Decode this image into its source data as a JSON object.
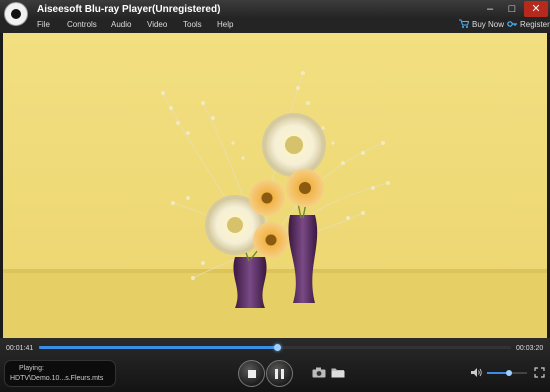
{
  "window": {
    "title": "Aiseesoft Blu-ray Player(Unregistered)",
    "minimize": "–",
    "maximize": "□",
    "close": "✕"
  },
  "menu": {
    "items": [
      "File",
      "Controls",
      "Audio",
      "Video",
      "Tools",
      "Help"
    ],
    "buy_now": "Buy Now",
    "register": "Register"
  },
  "playback": {
    "current_time": "00:01:41",
    "total_time": "00:03:20",
    "progress": 0.505,
    "status_label": "Playing:",
    "file_name": "HDTV\\Demo.10...s.Fleurs.mts",
    "volume": 0.55
  },
  "icons": [
    "app-logo-icon",
    "cart-icon",
    "key-icon",
    "stop-icon",
    "pause-icon",
    "camera-icon",
    "folder-icon",
    "speaker-icon",
    "fullscreen-icon"
  ],
  "colors": {
    "accent": "#3a8ee6",
    "background": "#1b1b1b",
    "video_wall": "#f0dc7a"
  }
}
